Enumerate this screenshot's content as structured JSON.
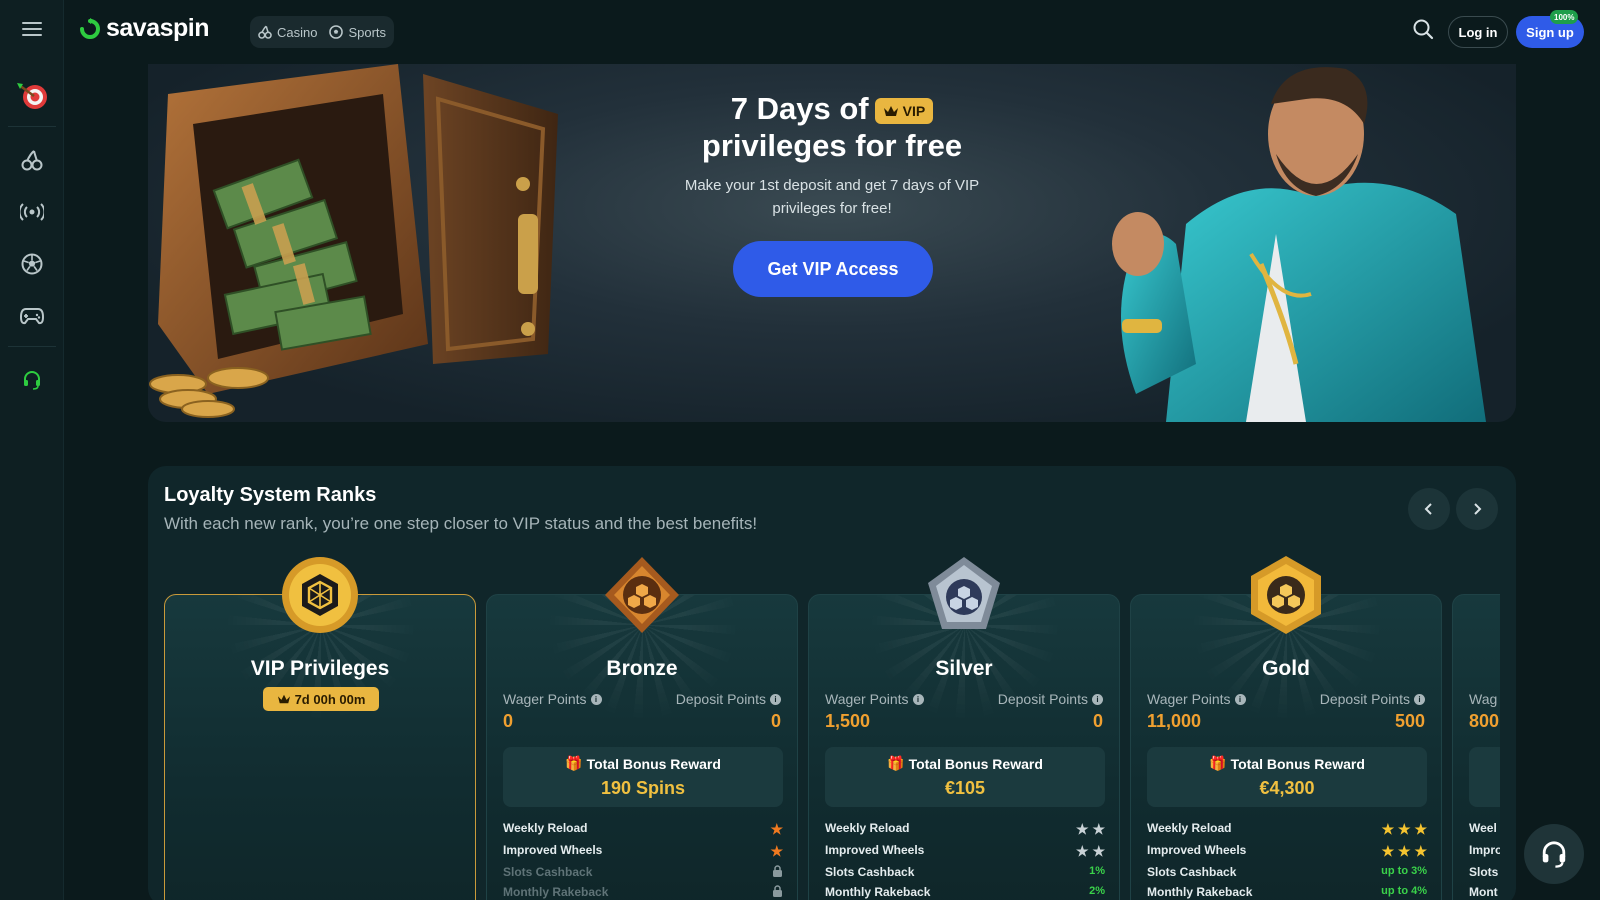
{
  "brand": {
    "name": "savaspin",
    "accent": "#2f5be8",
    "logo_color": "#2ecc40"
  },
  "header": {
    "tabs": [
      {
        "label": "Casino",
        "icon": "cherries-icon"
      },
      {
        "label": "Sports",
        "icon": "soccer-ball-icon"
      }
    ],
    "login_label": "Log in",
    "signup_label": "Sign up",
    "signup_badge": "100%"
  },
  "sidebar": {
    "items": [
      "menu-icon",
      "target-icon",
      "cherries-icon",
      "live-signal-icon",
      "soccer-ball-icon",
      "gamepad-icon",
      "support-icon"
    ]
  },
  "banner": {
    "title_line1": "7 Days of",
    "vip_chip": "VIP",
    "title_line2": "privileges for free",
    "subtitle": "Make your 1st deposit and get 7 days of VIP privileges for free!",
    "cta_label": "Get VIP Access"
  },
  "loyalty": {
    "title": "Loyalty System Ranks",
    "subtitle": "With each new rank, you’re one step closer to VIP status and the best benefits!",
    "wager_label": "Wager Points",
    "deposit_label": "Deposit Points",
    "reward_label": "Total Bonus Reward",
    "vip_card": {
      "name": "VIP Privileges",
      "timer": "7d 00h 00m"
    },
    "ranks": [
      {
        "name": "Bronze",
        "wager": "0",
        "deposit": "0",
        "reward": "190 Spins",
        "perks": [
          {
            "label": "Weekly Reload",
            "value": "★",
            "stars": 1
          },
          {
            "label": "Improved Wheels",
            "value": "★",
            "stars": 1
          },
          {
            "label": "Slots Cashback",
            "value": "",
            "locked": true
          },
          {
            "label": "Monthly Rakeback",
            "value": "",
            "locked": true
          }
        ]
      },
      {
        "name": "Silver",
        "wager": "1,500",
        "deposit": "0",
        "reward": "€105",
        "perks": [
          {
            "label": "Weekly Reload",
            "value": "★ ★",
            "stars": 2
          },
          {
            "label": "Improved Wheels",
            "value": "★ ★",
            "stars": 2
          },
          {
            "label": "Slots Cashback",
            "value": "1%"
          },
          {
            "label": "Monthly Rakeback",
            "value": "2%"
          }
        ]
      },
      {
        "name": "Gold",
        "wager": "11,000",
        "deposit": "500",
        "reward": "€4,300",
        "perks": [
          {
            "label": "Weekly Reload",
            "value": "★ ★ ★",
            "stars": 3
          },
          {
            "label": "Improved Wheels",
            "value": "★ ★ ★",
            "stars": 3
          },
          {
            "label": "Slots Cashback",
            "value": "up to 3%"
          },
          {
            "label": "Monthly Rakeback",
            "value": "up to 4%"
          }
        ]
      },
      {
        "name": "",
        "wager_label_partial": "Wag",
        "wager": "800",
        "perks": [
          {
            "label": "Weel"
          },
          {
            "label": "Impro"
          },
          {
            "label": "Slots"
          },
          {
            "label": "Mont"
          }
        ]
      }
    ]
  },
  "colors": {
    "gold": "#e9b640",
    "orange_value": "#f0a030",
    "green_value": "#3ad24a",
    "bronze_star": "#f07a20",
    "silver_star": "#c9d2d6",
    "gold_star": "#f5c430"
  }
}
